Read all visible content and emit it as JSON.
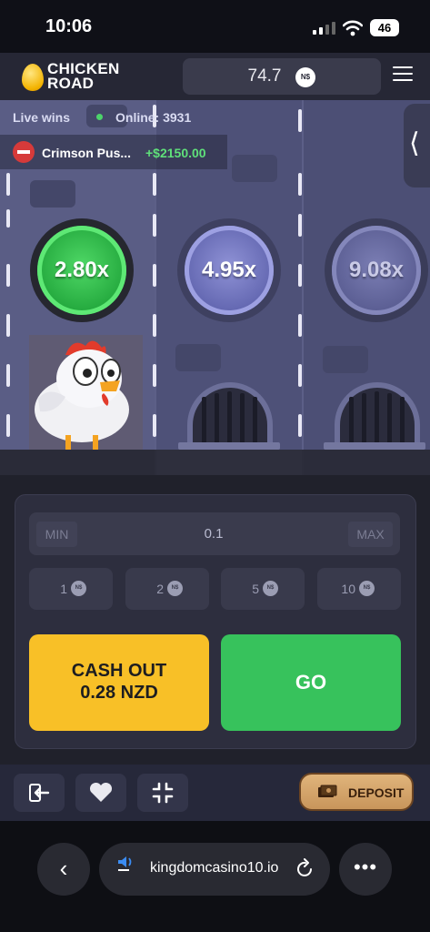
{
  "status_bar": {
    "time": "10:06",
    "battery": "46"
  },
  "header": {
    "logo_line1": "CHICKEN",
    "logo_line2": "ROAD",
    "balance": "74.7",
    "currency_badge": "N$"
  },
  "live": {
    "live_wins_label": "Live wins",
    "online_label": "Online: 3931",
    "winner_name": "Crimson Pus...",
    "winner_amount": "+$2150.00"
  },
  "multipliers": [
    "2.80x",
    "4.95x",
    "9.08x"
  ],
  "controls": {
    "min_label": "MIN",
    "max_label": "MAX",
    "bet_value": "0.1",
    "chips": [
      "1",
      "2",
      "5",
      "10"
    ],
    "chip_currency": "N$",
    "cashout_line1": "CASH OUT",
    "cashout_line2": "0.28 NZD",
    "go_label": "GO"
  },
  "toolbar": {
    "deposit_label": "DEPOSIT"
  },
  "browser": {
    "url": "kingdomcasino10.io"
  },
  "colors": {
    "accent_green": "#37c25c",
    "cashout_yellow": "#f8c027",
    "active_multiplier": "#23a83d",
    "background": "#20212b"
  },
  "icons": [
    "signal-icon",
    "wifi-icon",
    "battery-icon",
    "menu-icon",
    "chevron-left-icon",
    "exit-icon",
    "heart-icon",
    "fullscreen-exit-icon",
    "money-icon",
    "speaker-icon",
    "reload-icon",
    "more-icon"
  ]
}
